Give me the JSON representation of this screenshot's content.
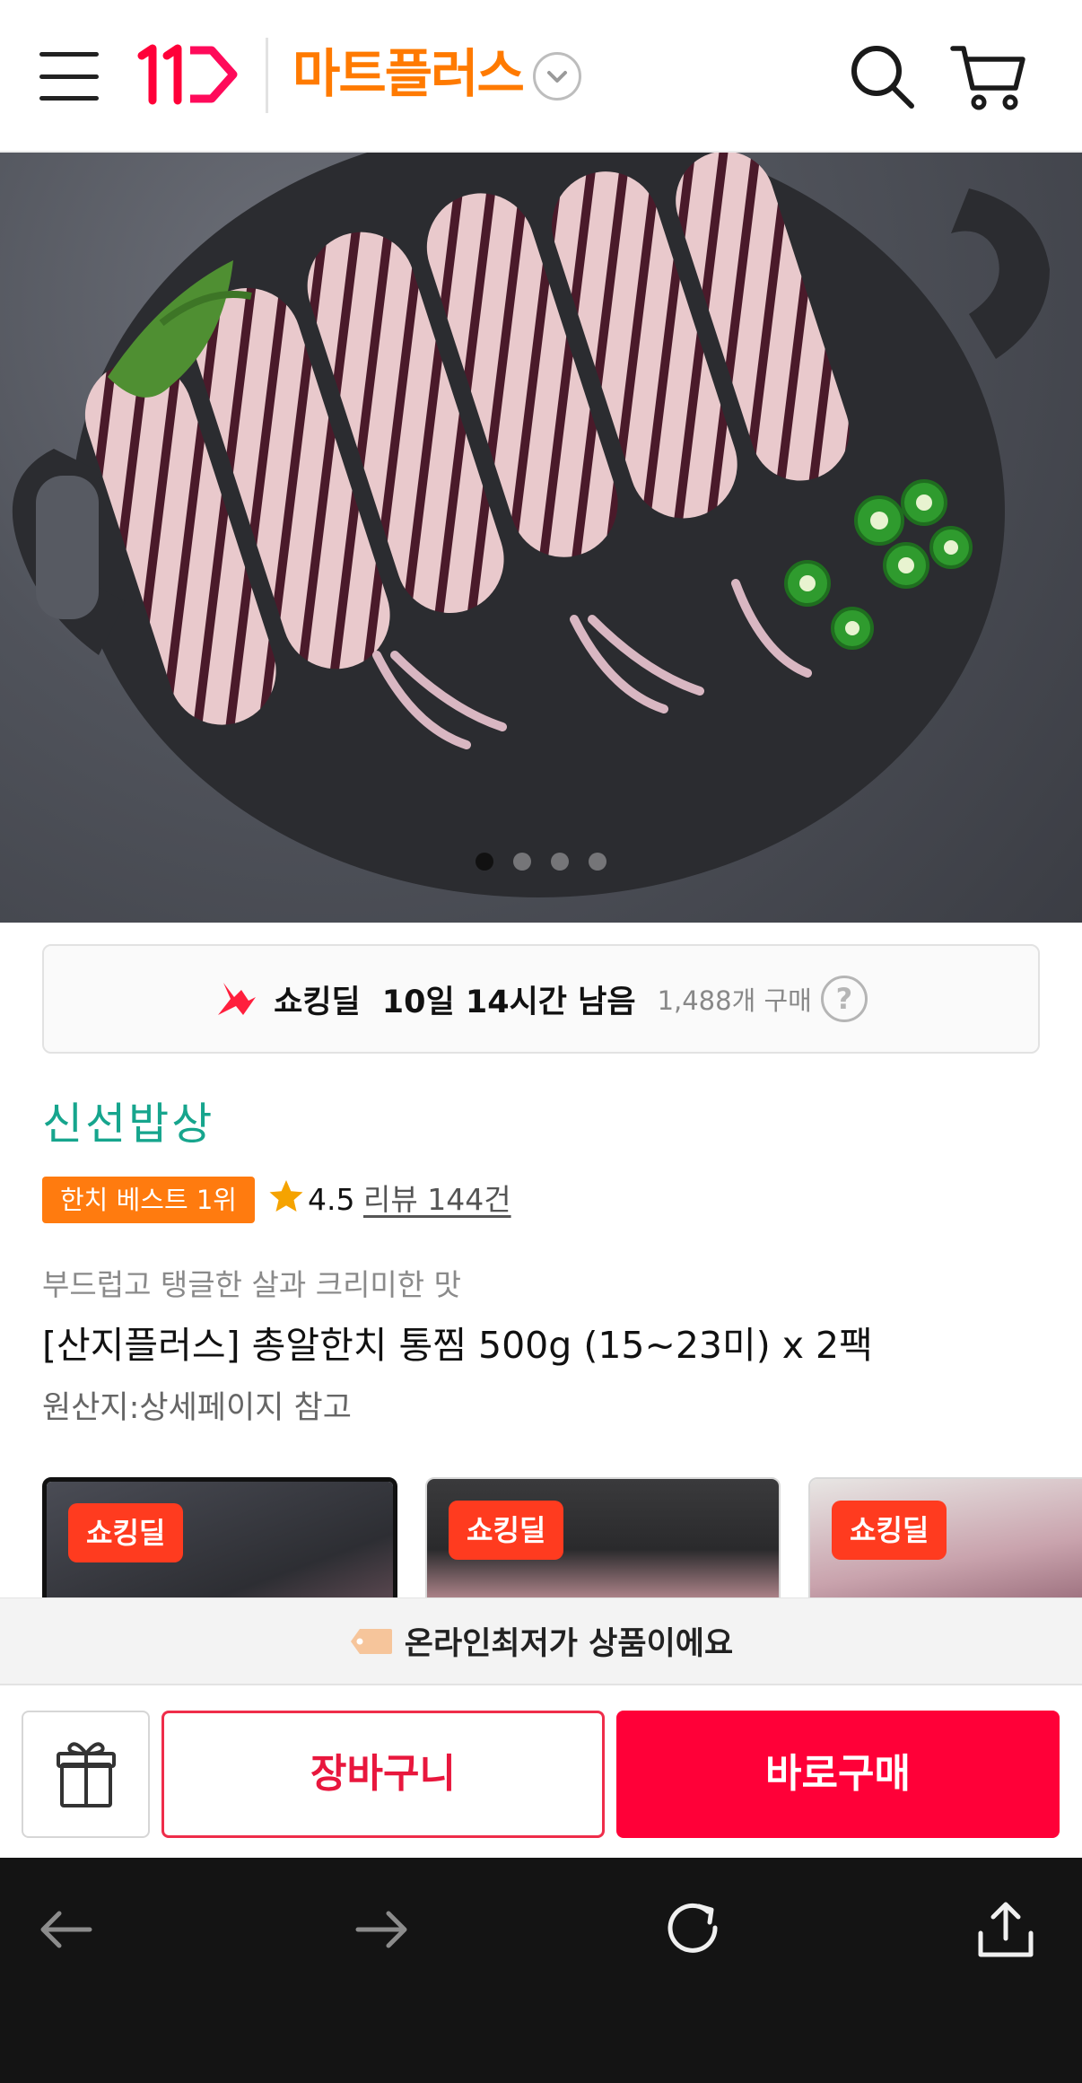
{
  "header": {
    "logo_text": "11",
    "brand": "마트플러스"
  },
  "gallery": {
    "slides": 4,
    "active_index": 0
  },
  "deal": {
    "label": "쇼킹딜",
    "time_left": "10일 14시간 남음",
    "purchase_count": "1,488개 구매",
    "help": "?"
  },
  "product": {
    "seller": "신선밥상",
    "rank_badge": "한치 베스트 1위",
    "rating": "4.5",
    "review_link": "리뷰 144건",
    "subtitle": "부드럽고 탱글한 살과 크리미한 맛",
    "title": "[산지플러스] 총알한치 통찜 500g (15~23미) x 2팩",
    "origin": "원산지:상세페이지 참고"
  },
  "thumbnails": [
    {
      "badge": "쇼킹딜",
      "selected": true
    },
    {
      "badge": "쇼킹딜",
      "selected": false
    },
    {
      "badge": "쇼킹딜",
      "selected": false
    }
  ],
  "banner": {
    "text": "온라인최저가 상품이에요"
  },
  "buybar": {
    "cart_label": "장바구니",
    "buy_label": "바로구매"
  },
  "colors": {
    "brand_orange": "#ff7a00",
    "seller_green": "#16a58d",
    "buy_red": "#ff0038",
    "badge_orange": "#ff7b0f"
  }
}
